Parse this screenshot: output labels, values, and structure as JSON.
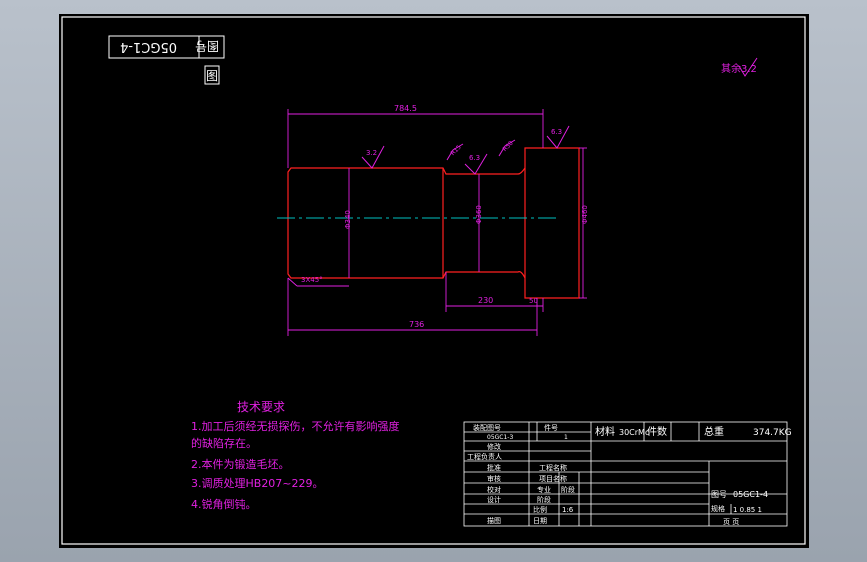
{
  "drawing_no": "05GC1-4",
  "drawing_no_label": "图号",
  "view_label": "图",
  "roughness_note": "其余3.2",
  "dims": {
    "d_784": "784.5",
    "d_236": "736",
    "d_230": "230",
    "d_50": "50",
    "chamfer": "3X45°",
    "phi_left": "Φ340",
    "phi_mid": "Φ360",
    "phi_right": "Φ460",
    "r1": "3.2",
    "r2": "6.3",
    "r3": "6.3",
    "r_left": "3.2",
    "r_tilt1": "R15",
    "r_tilt2": "R50"
  },
  "tech": {
    "title": "技术要求",
    "lines": [
      "1.加工后须经无损探伤，不允许有影响强度",
      "的缺陷存在。",
      "2.本件为锻造毛坯。",
      "3.调质处理HB207~229。",
      "4.锐角倒钝。"
    ]
  },
  "titleblock": {
    "h1": "装配图号",
    "h2": "件号",
    "h1_val": "05GC1-3",
    "h2_val": "1",
    "material_label": "材料",
    "material": "30CrMo",
    "qty_label": "件数",
    "weight_label": "总重",
    "weight": "374.7KG",
    "r_revise": "修改",
    "r_engineer": "工程负责人",
    "r_approve": "批准",
    "r_check": "审核",
    "r_review": "校对",
    "r_design": "设计",
    "r_draw": "描图",
    "proj_name": "工程名称",
    "proj_item": "项目名称",
    "stage_a": "专业",
    "stage_b": "阶段",
    "stage_c": "阶段",
    "scale_label": "比例",
    "scale": "1:6",
    "date_label": "日期",
    "dwg_label": "图号",
    "dwg_val": "05GC1-4",
    "sheet_label": "规格",
    "sheet_val": "1  0.85  1",
    "pages": "页 页"
  }
}
